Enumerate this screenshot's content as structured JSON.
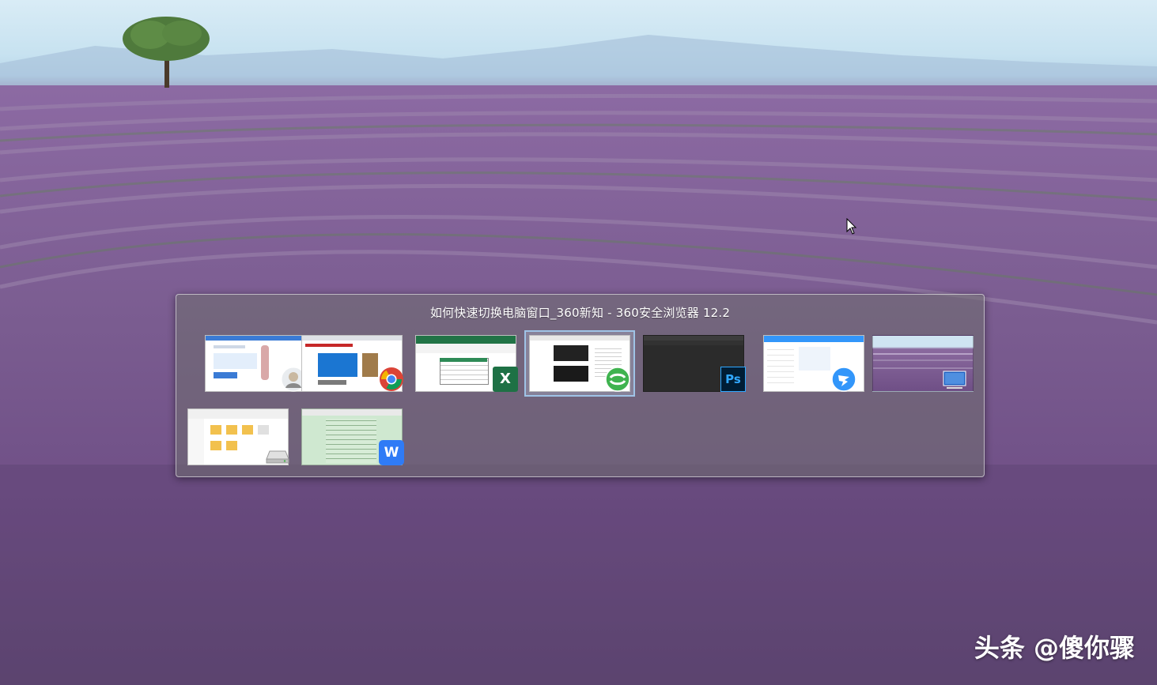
{
  "switcher": {
    "title": "如何快速切换电脑窗口_360新知 - 360安全浏览器 12.2",
    "windows": [
      {
        "app": "qq-video-app",
        "icon": "avatar-icon",
        "selected": false
      },
      {
        "app": "chrome",
        "icon": "chrome-icon",
        "selected": false
      },
      {
        "app": "excel",
        "icon": "excel-icon",
        "icon_letter": "X",
        "selected": false
      },
      {
        "app": "360-browser",
        "icon": "360-browser-icon",
        "selected": true
      },
      {
        "app": "photoshop",
        "icon": "photoshop-icon",
        "icon_letter": "Ps",
        "selected": false
      },
      {
        "app": "dingtalk",
        "icon": "dingtalk-icon",
        "selected": false
      },
      {
        "app": "desktop",
        "icon": "desktop-icon",
        "selected": false
      },
      {
        "app": "file-explorer",
        "icon": "drive-icon",
        "selected": false
      },
      {
        "app": "wps-writer",
        "icon": "wps-icon",
        "icon_letter": "W",
        "selected": false
      }
    ]
  },
  "watermark": "头条 @傻你骤",
  "colors": {
    "excel": "#1e7145",
    "photoshop_bg": "#001d34",
    "photoshop_fg": "#31a8ff",
    "browser_360": "#3fb34f",
    "dingtalk": "#3296fa",
    "wps": "#2f7bf6",
    "selection": "#9fc3e6"
  }
}
